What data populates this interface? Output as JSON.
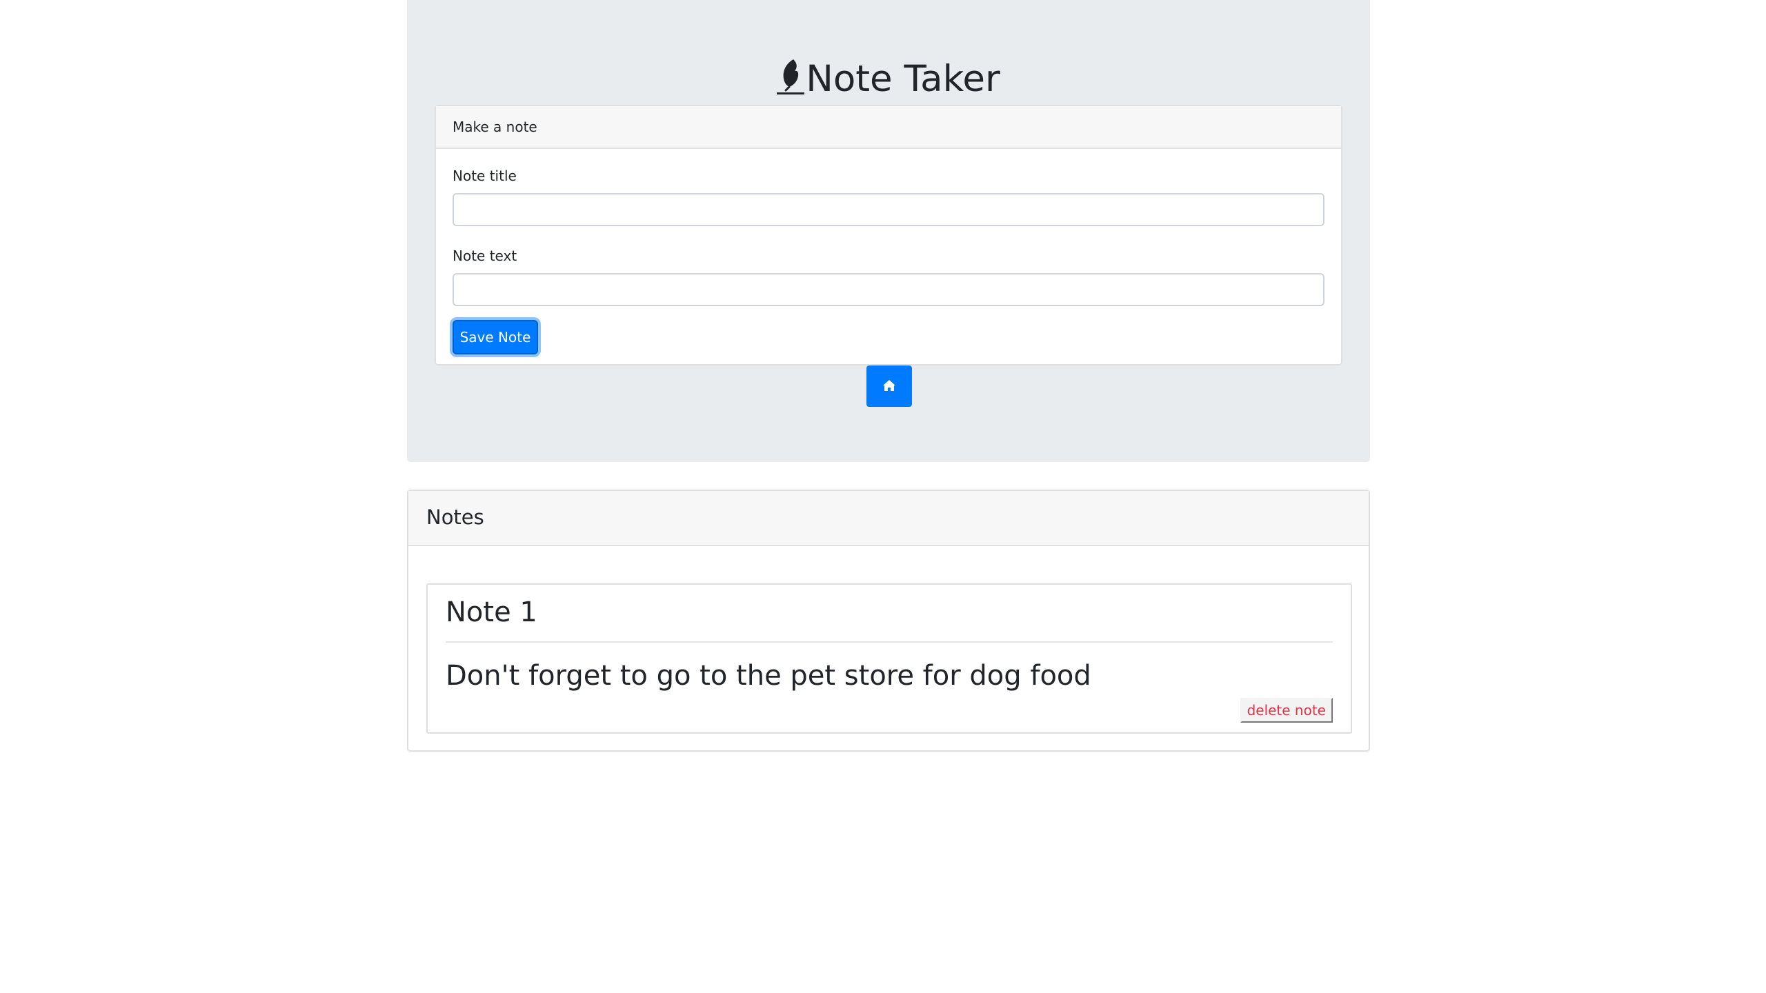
{
  "header": {
    "title": "Note Taker",
    "logo_icon": "feather-icon"
  },
  "form": {
    "card_title": "Make a note",
    "title_label": "Note title",
    "title_value": "",
    "text_label": "Note text",
    "text_value": "",
    "save_label": "Save Note",
    "home_icon": "home-icon"
  },
  "notes": {
    "header": "Notes",
    "items": [
      {
        "title": "Note 1",
        "text": "Don't forget to go to the pet store for dog food",
        "delete_label": "delete note"
      }
    ]
  },
  "colors": {
    "primary": "#007bff",
    "danger": "#dc3545",
    "jumbotron_bg": "#e9ecef"
  }
}
